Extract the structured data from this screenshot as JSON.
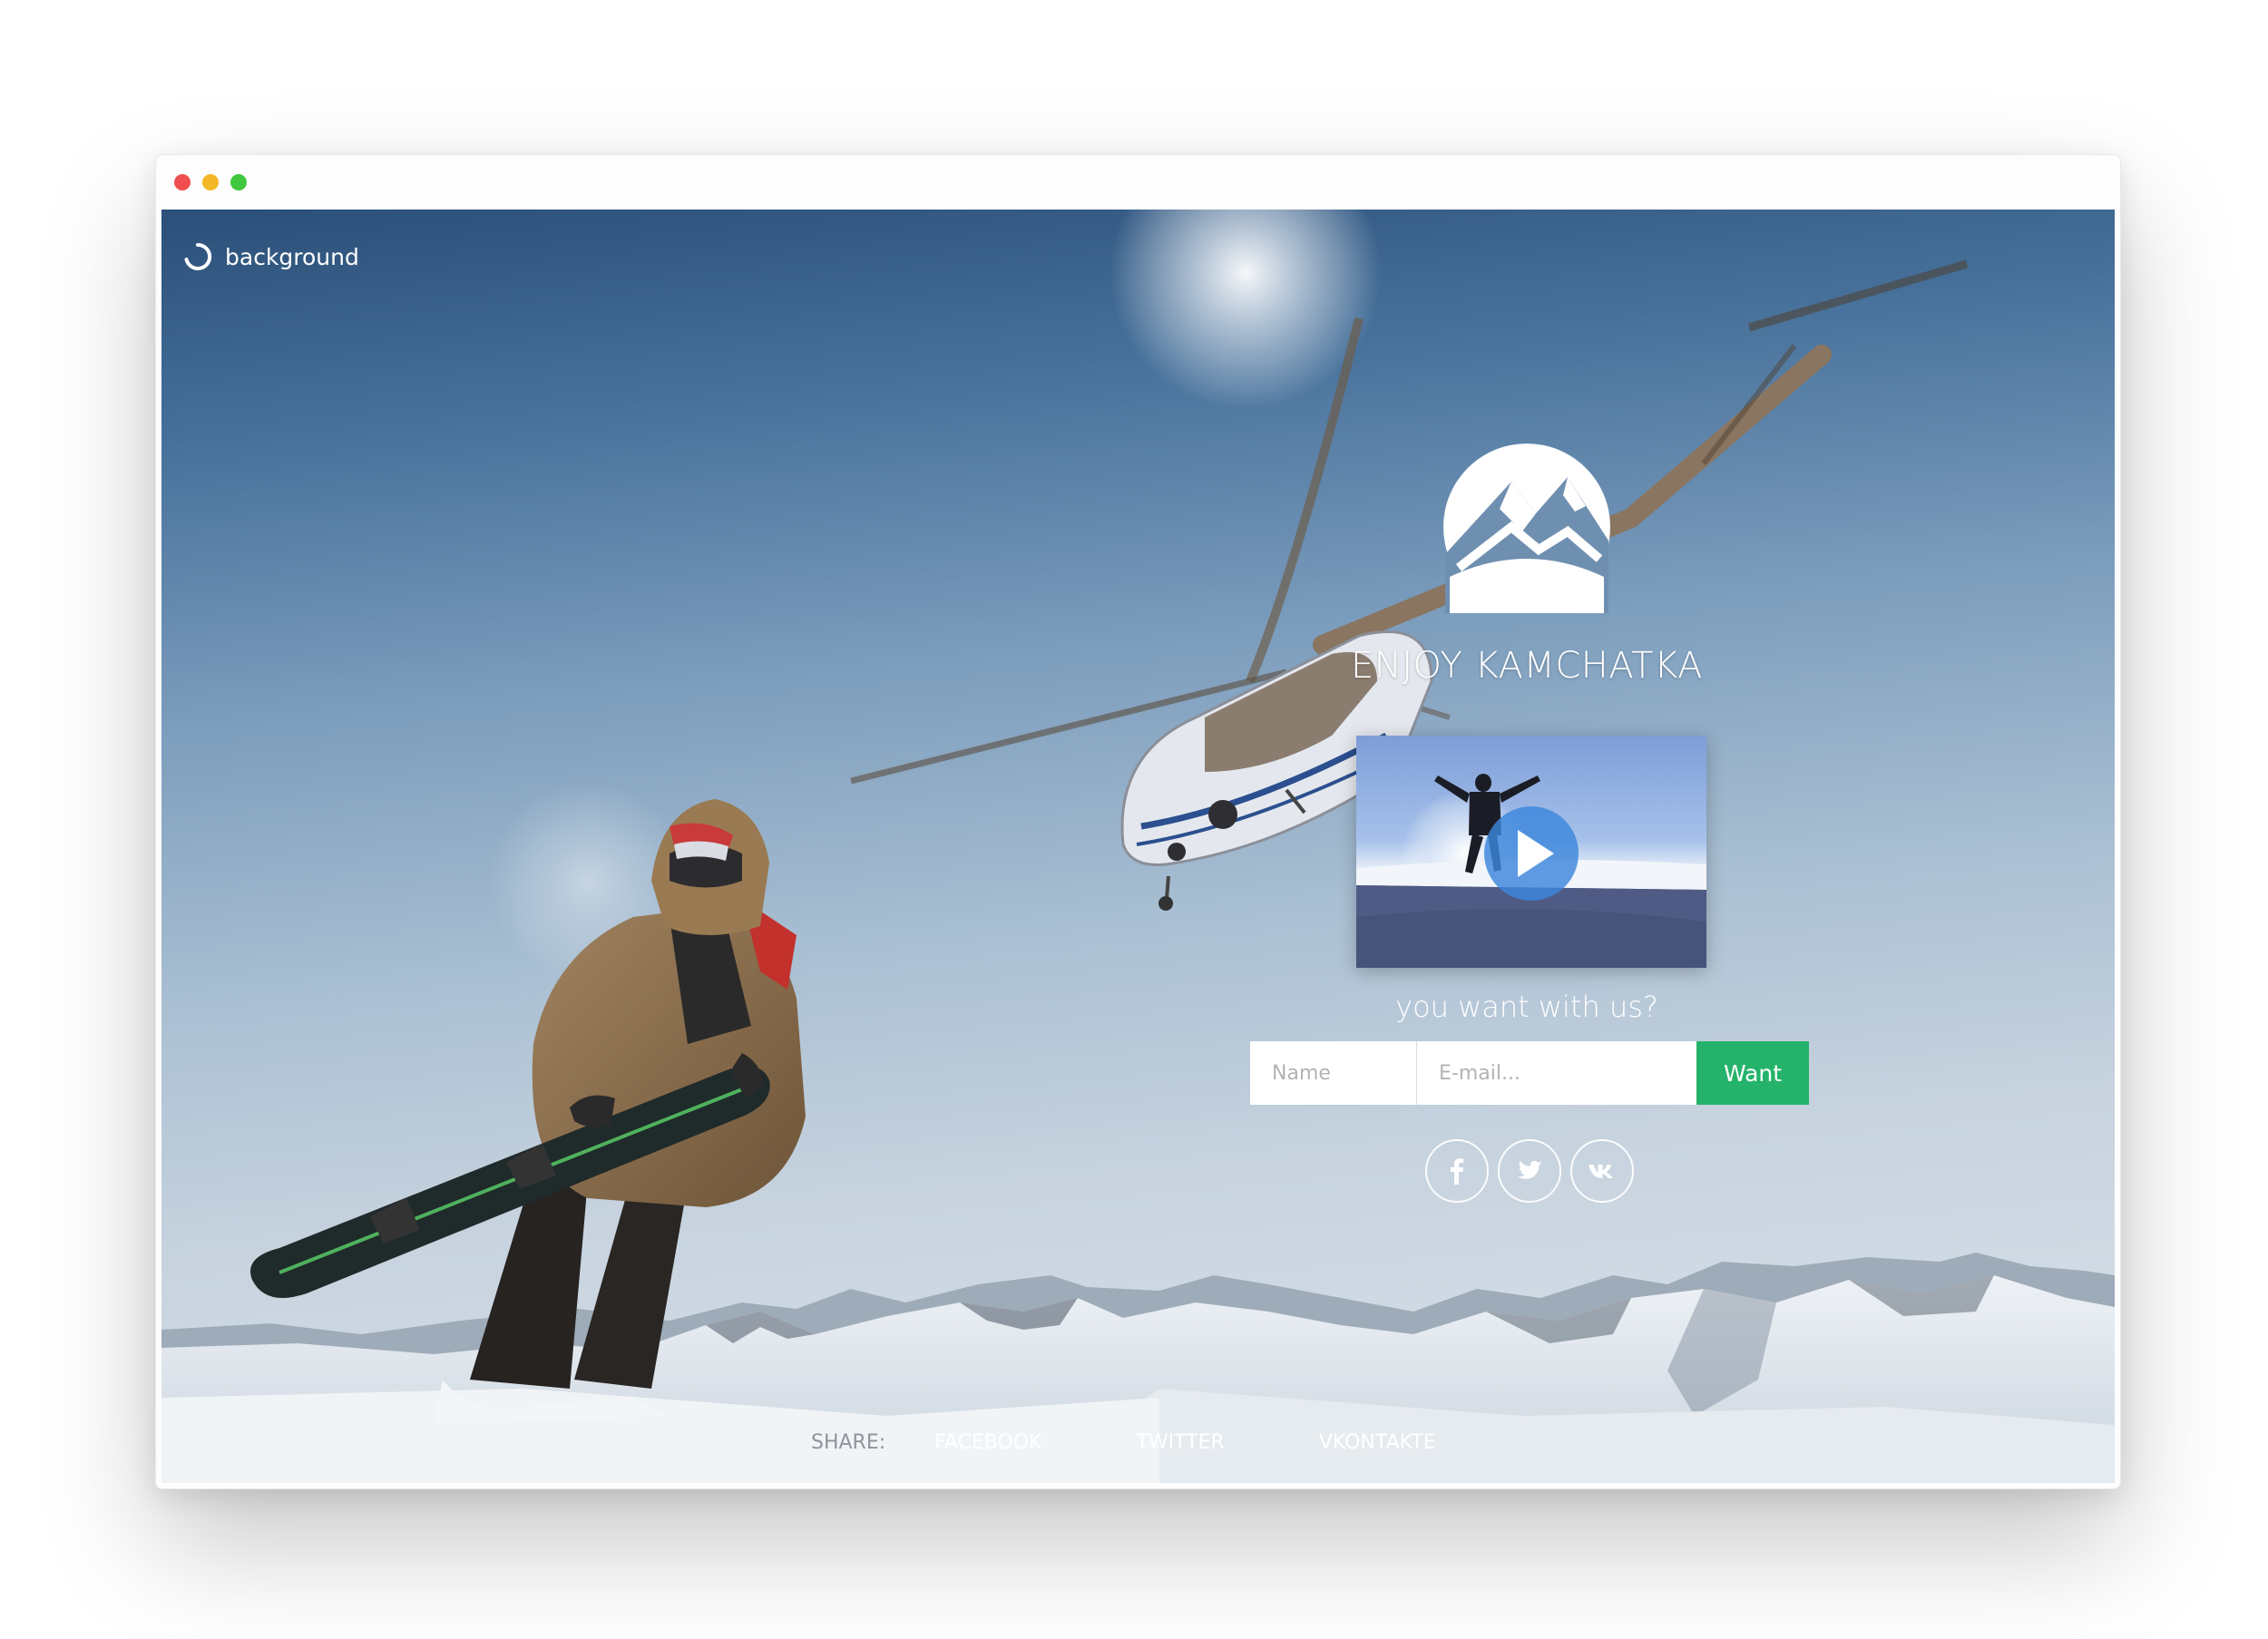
{
  "window": {
    "controls": [
      "close",
      "minimize",
      "maximize"
    ]
  },
  "brand": {
    "icon": "loader-spinner-icon",
    "label": "background"
  },
  "hero": {
    "logo_icon": "mountain-circle-logo-icon",
    "title": "ENJOY KAMCHATKA",
    "video": {
      "thumbnail": "snowboarder-on-summit-thumbnail",
      "play_icon": "play-icon"
    },
    "question": "you want with us?"
  },
  "signup": {
    "name_placeholder": "Name",
    "email_placeholder": "E-mail...",
    "submit_label": "Want",
    "accent_color": "#25b36b"
  },
  "social_icons": [
    {
      "name": "facebook-icon"
    },
    {
      "name": "twitter-icon"
    },
    {
      "name": "vkontakte-icon"
    }
  ],
  "share": {
    "label": "SHARE:",
    "links": [
      "FACEBOOK",
      "TWITTER",
      "VKONTAKTE"
    ]
  }
}
